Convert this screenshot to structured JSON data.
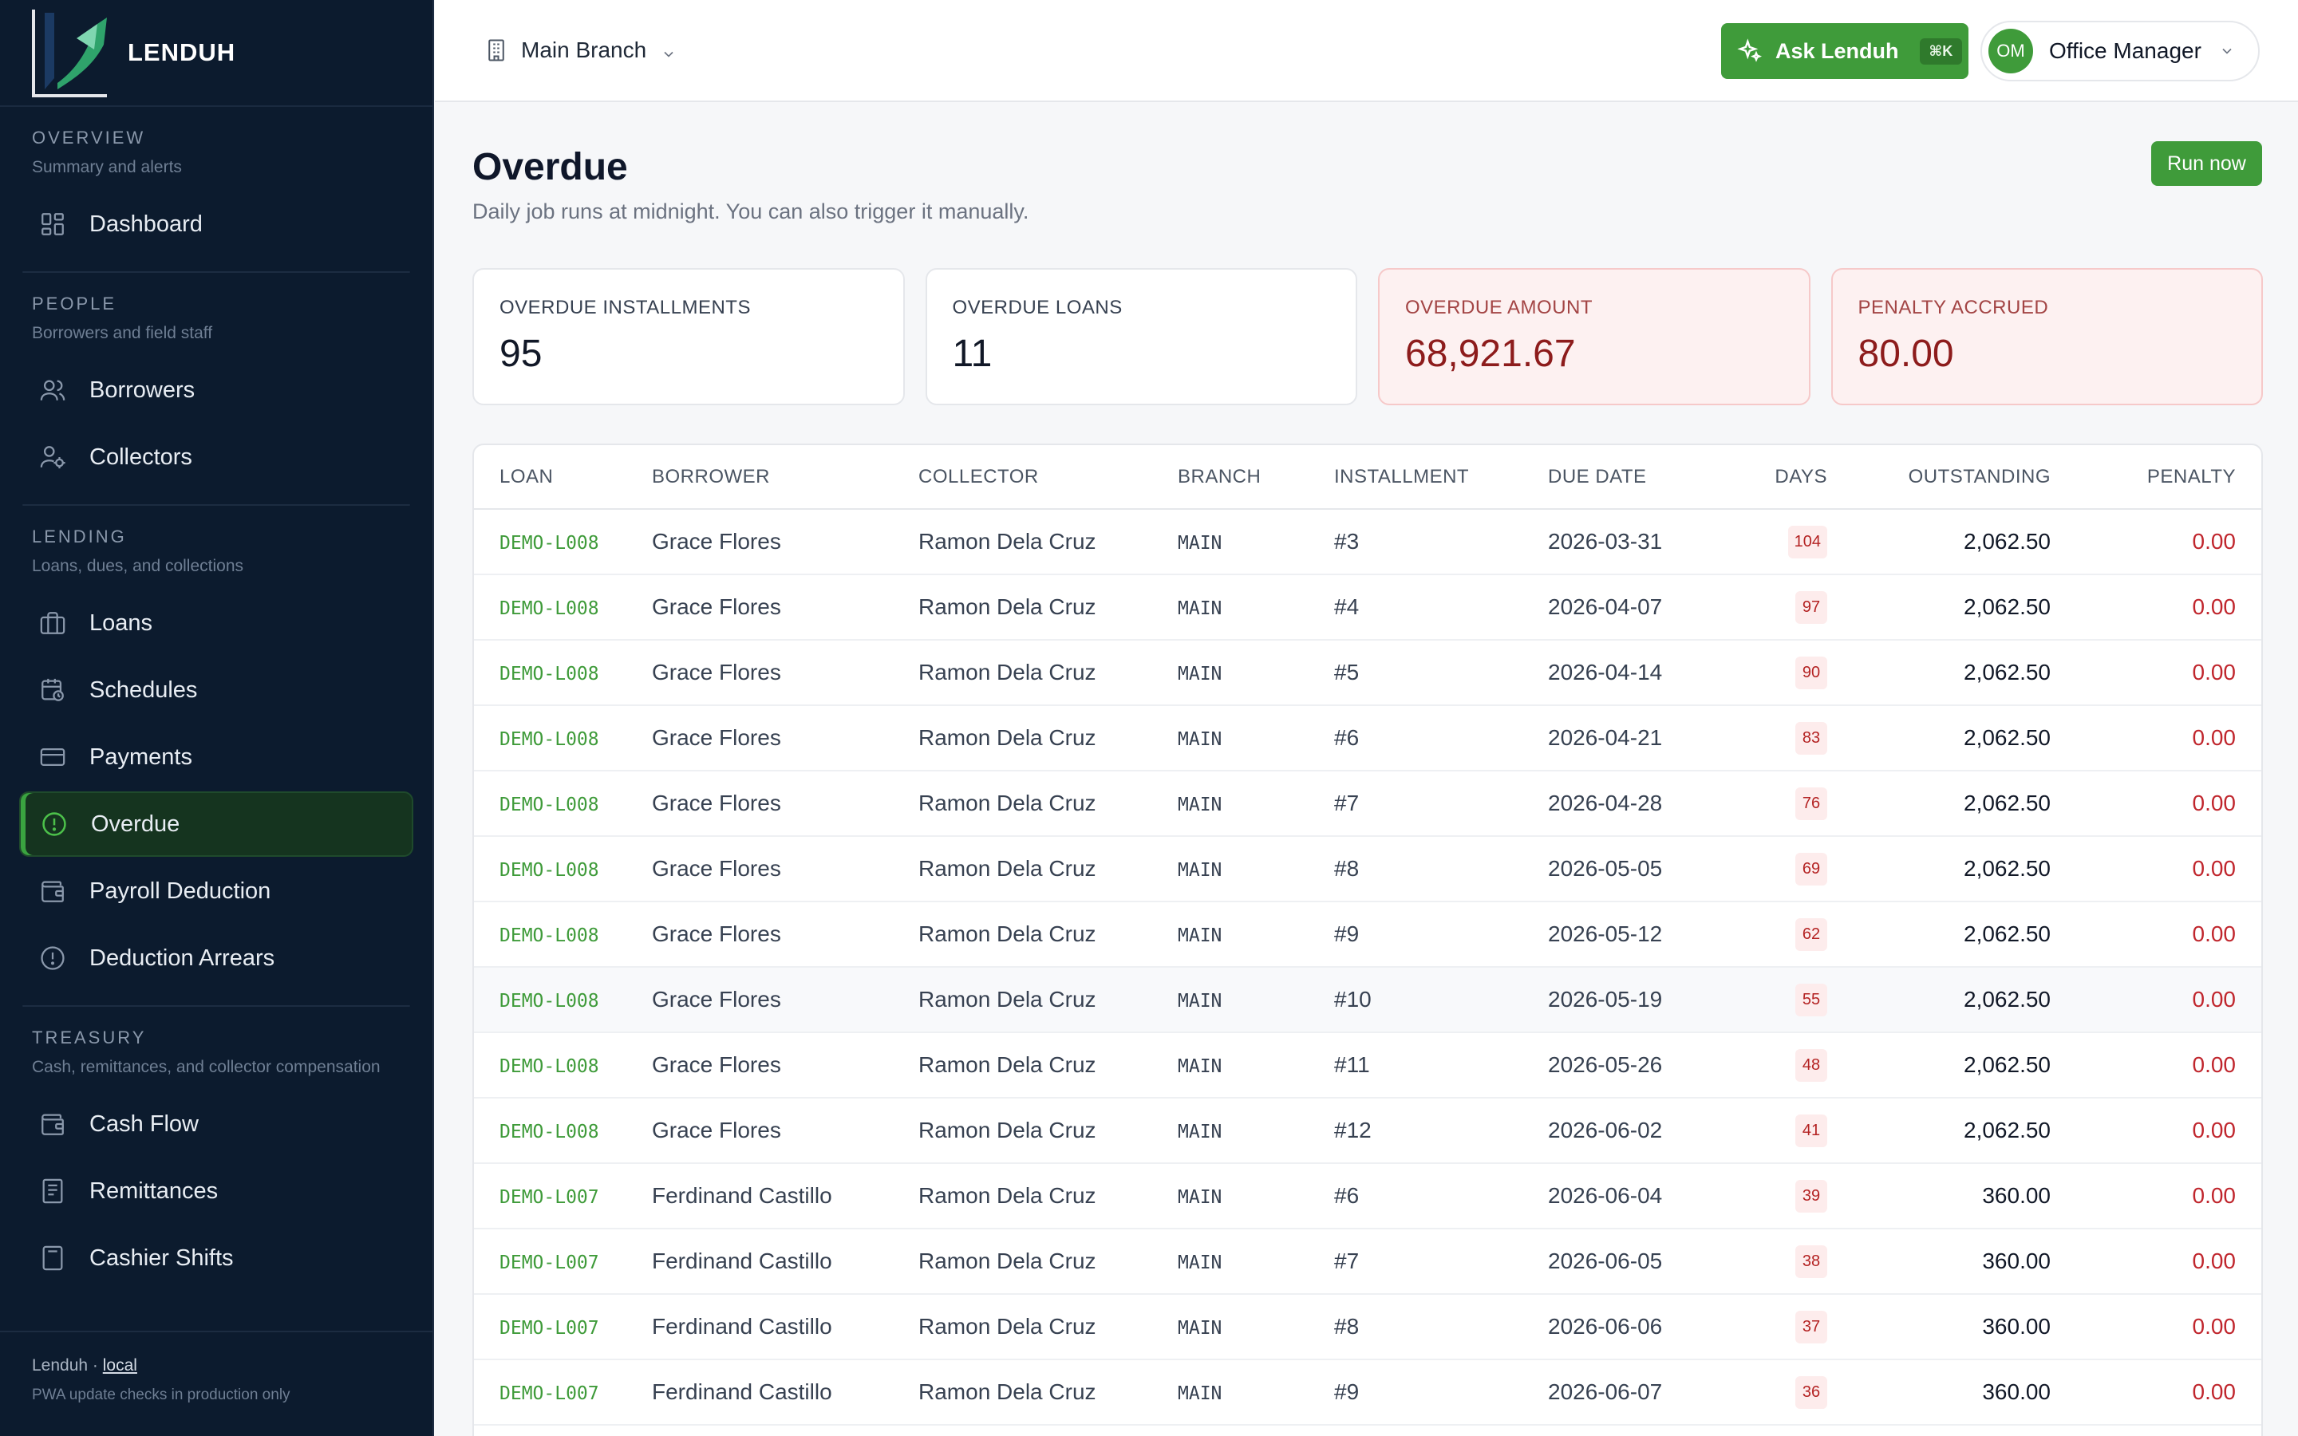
{
  "brand": {
    "name": "LENDUH"
  },
  "sidebar": {
    "sections": [
      {
        "title": "OVERVIEW",
        "subtitle": "Summary and alerts",
        "items": [
          {
            "label": "Dashboard",
            "icon": "dashboard-icon"
          }
        ]
      },
      {
        "title": "PEOPLE",
        "subtitle": "Borrowers and field staff",
        "items": [
          {
            "label": "Borrowers",
            "icon": "users-icon"
          },
          {
            "label": "Collectors",
            "icon": "collector-icon"
          }
        ]
      },
      {
        "title": "LENDING",
        "subtitle": "Loans, dues, and collections",
        "items": [
          {
            "label": "Loans",
            "icon": "briefcase-icon"
          },
          {
            "label": "Schedules",
            "icon": "calendar-clock-icon"
          },
          {
            "label": "Payments",
            "icon": "credit-card-icon"
          },
          {
            "label": "Overdue",
            "icon": "alert-circle-icon",
            "active": true
          },
          {
            "label": "Payroll Deduction",
            "icon": "wallet-icon"
          },
          {
            "label": "Deduction Arrears",
            "icon": "alert-circle-icon"
          }
        ]
      },
      {
        "title": "TREASURY",
        "subtitle": "Cash, remittances, and collector compensation",
        "items": [
          {
            "label": "Cash Flow",
            "icon": "wallet-icon"
          },
          {
            "label": "Remittances",
            "icon": "receipt-icon"
          },
          {
            "label": "Cashier Shifts",
            "icon": "calculator-icon"
          }
        ]
      }
    ],
    "footer": {
      "app": "Lenduh",
      "separator": " · ",
      "env": "local",
      "note": "PWA update checks in production only"
    }
  },
  "topbar": {
    "branch": "Main Branch",
    "ask_label": "Ask Lenduh",
    "ask_shortcut": "⌘K",
    "user_initials": "OM",
    "user_name": "Office Manager"
  },
  "page": {
    "title": "Overdue",
    "subtitle": "Daily job runs at midnight. You can also trigger it manually.",
    "run_label": "Run now"
  },
  "stats": [
    {
      "label": "OVERDUE INSTALLMENTS",
      "value": "95",
      "tone": "neutral"
    },
    {
      "label": "OVERDUE LOANS",
      "value": "11",
      "tone": "neutral"
    },
    {
      "label": "OVERDUE AMOUNT",
      "value": "68,921.67",
      "tone": "danger"
    },
    {
      "label": "PENALTY ACCRUED",
      "value": "80.00",
      "tone": "danger"
    }
  ],
  "table": {
    "columns": [
      "LOAN",
      "BORROWER",
      "COLLECTOR",
      "BRANCH",
      "INSTALLMENT",
      "DUE DATE",
      "DAYS",
      "OUTSTANDING",
      "PENALTY"
    ],
    "rows": [
      {
        "loan": "DEMO-L008",
        "borrower": "Grace Flores",
        "collector": "Ramon Dela Cruz",
        "branch": "MAIN",
        "installment": "#3",
        "due": "2026-03-31",
        "days": "104",
        "outstanding": "2,062.50",
        "penalty": "0.00"
      },
      {
        "loan": "DEMO-L008",
        "borrower": "Grace Flores",
        "collector": "Ramon Dela Cruz",
        "branch": "MAIN",
        "installment": "#4",
        "due": "2026-04-07",
        "days": "97",
        "outstanding": "2,062.50",
        "penalty": "0.00"
      },
      {
        "loan": "DEMO-L008",
        "borrower": "Grace Flores",
        "collector": "Ramon Dela Cruz",
        "branch": "MAIN",
        "installment": "#5",
        "due": "2026-04-14",
        "days": "90",
        "outstanding": "2,062.50",
        "penalty": "0.00"
      },
      {
        "loan": "DEMO-L008",
        "borrower": "Grace Flores",
        "collector": "Ramon Dela Cruz",
        "branch": "MAIN",
        "installment": "#6",
        "due": "2026-04-21",
        "days": "83",
        "outstanding": "2,062.50",
        "penalty": "0.00"
      },
      {
        "loan": "DEMO-L008",
        "borrower": "Grace Flores",
        "collector": "Ramon Dela Cruz",
        "branch": "MAIN",
        "installment": "#7",
        "due": "2026-04-28",
        "days": "76",
        "outstanding": "2,062.50",
        "penalty": "0.00"
      },
      {
        "loan": "DEMO-L008",
        "borrower": "Grace Flores",
        "collector": "Ramon Dela Cruz",
        "branch": "MAIN",
        "installment": "#8",
        "due": "2026-05-05",
        "days": "69",
        "outstanding": "2,062.50",
        "penalty": "0.00"
      },
      {
        "loan": "DEMO-L008",
        "borrower": "Grace Flores",
        "collector": "Ramon Dela Cruz",
        "branch": "MAIN",
        "installment": "#9",
        "due": "2026-05-12",
        "days": "62",
        "outstanding": "2,062.50",
        "penalty": "0.00"
      },
      {
        "loan": "DEMO-L008",
        "borrower": "Grace Flores",
        "collector": "Ramon Dela Cruz",
        "branch": "MAIN",
        "installment": "#10",
        "due": "2026-05-19",
        "days": "55",
        "outstanding": "2,062.50",
        "penalty": "0.00",
        "highlighted": true
      },
      {
        "loan": "DEMO-L008",
        "borrower": "Grace Flores",
        "collector": "Ramon Dela Cruz",
        "branch": "MAIN",
        "installment": "#11",
        "due": "2026-05-26",
        "days": "48",
        "outstanding": "2,062.50",
        "penalty": "0.00"
      },
      {
        "loan": "DEMO-L008",
        "borrower": "Grace Flores",
        "collector": "Ramon Dela Cruz",
        "branch": "MAIN",
        "installment": "#12",
        "due": "2026-06-02",
        "days": "41",
        "outstanding": "2,062.50",
        "penalty": "0.00"
      },
      {
        "loan": "DEMO-L007",
        "borrower": "Ferdinand Castillo",
        "collector": "Ramon Dela Cruz",
        "branch": "MAIN",
        "installment": "#6",
        "due": "2026-06-04",
        "days": "39",
        "outstanding": "360.00",
        "penalty": "0.00"
      },
      {
        "loan": "DEMO-L007",
        "borrower": "Ferdinand Castillo",
        "collector": "Ramon Dela Cruz",
        "branch": "MAIN",
        "installment": "#7",
        "due": "2026-06-05",
        "days": "38",
        "outstanding": "360.00",
        "penalty": "0.00"
      },
      {
        "loan": "DEMO-L007",
        "borrower": "Ferdinand Castillo",
        "collector": "Ramon Dela Cruz",
        "branch": "MAIN",
        "installment": "#8",
        "due": "2026-06-06",
        "days": "37",
        "outstanding": "360.00",
        "penalty": "0.00"
      },
      {
        "loan": "DEMO-L007",
        "borrower": "Ferdinand Castillo",
        "collector": "Ramon Dela Cruz",
        "branch": "MAIN",
        "installment": "#9",
        "due": "2026-06-07",
        "days": "36",
        "outstanding": "360.00",
        "penalty": "0.00"
      }
    ]
  },
  "colors": {
    "accent": "#3f9b3a",
    "sidebar_bg": "#0c1b2e",
    "danger": "#c0262d",
    "danger_bg": "#fdf1f1"
  }
}
